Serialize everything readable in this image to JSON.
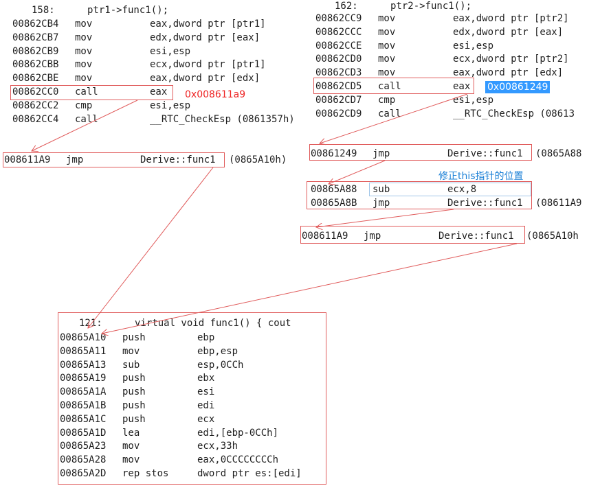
{
  "left_block": {
    "header_line": "158",
    "header_code": "ptr1->func1();",
    "rows": [
      {
        "addr": "00862CB4",
        "op": "mov",
        "args": "eax,dword ptr [ptr1]"
      },
      {
        "addr": "00862CB7",
        "op": "mov",
        "args": "edx,dword ptr [eax]"
      },
      {
        "addr": "00862CB9",
        "op": "mov",
        "args": "esi,esp"
      },
      {
        "addr": "00862CBB",
        "op": "mov",
        "args": "ecx,dword ptr [ptr1]"
      },
      {
        "addr": "00862CBE",
        "op": "mov",
        "args": "eax,dword ptr [edx]"
      },
      {
        "addr": "00862CC0",
        "op": "call",
        "args": "eax"
      },
      {
        "addr": "00862CC2",
        "op": "cmp",
        "args": "esi,esp"
      },
      {
        "addr": "00862CC4",
        "op": "call",
        "args": "__RTC_CheckEsp (0861357h)"
      }
    ],
    "annotation": "0x008611a9"
  },
  "left_jump": {
    "addr": "008611A9",
    "op": "jmp",
    "args": "Derive::func1",
    "suffix": "(0865A10h)"
  },
  "right_block": {
    "header_line": "162",
    "header_code": "ptr2->func1();",
    "rows": [
      {
        "addr": "00862CC9",
        "op": "mov",
        "args": "eax,dword ptr [ptr2]"
      },
      {
        "addr": "00862CCC",
        "op": "mov",
        "args": "edx,dword ptr [eax]"
      },
      {
        "addr": "00862CCE",
        "op": "mov",
        "args": "esi,esp"
      },
      {
        "addr": "00862CD0",
        "op": "mov",
        "args": "ecx,dword ptr [ptr2]"
      },
      {
        "addr": "00862CD3",
        "op": "mov",
        "args": "eax,dword ptr [edx]"
      },
      {
        "addr": "00862CD5",
        "op": "call",
        "args": "eax"
      },
      {
        "addr": "00862CD7",
        "op": "cmp",
        "args": "esi,esp"
      },
      {
        "addr": "00862CD9",
        "op": "call",
        "args": "__RTC_CheckEsp (08613"
      }
    ],
    "annotation": "0x00861249"
  },
  "right_jump1": {
    "addr": "00861249",
    "op": "jmp",
    "args": "Derive::func1",
    "suffix": "(0865A88"
  },
  "thunk_note": "修正this指针的位置",
  "thunk_rows": [
    {
      "addr": "00865A88",
      "op": "sub",
      "args": "ecx,8",
      "suffix": ""
    },
    {
      "addr": "00865A8B",
      "op": "jmp",
      "args": "Derive::func1",
      "suffix": "(08611A9"
    }
  ],
  "right_jump2": {
    "addr": "008611A9",
    "op": "jmp",
    "args": "Derive::func1",
    "suffix": "(0865A10h"
  },
  "func_block": {
    "header_line": "121",
    "header_code": "virtual void func1() { cout",
    "rows": [
      {
        "addr": "00865A10",
        "op": "push",
        "args": "ebp"
      },
      {
        "addr": "00865A11",
        "op": "mov",
        "args": "ebp,esp"
      },
      {
        "addr": "00865A13",
        "op": "sub",
        "args": "esp,0CCh"
      },
      {
        "addr": "00865A19",
        "op": "push",
        "args": "ebx"
      },
      {
        "addr": "00865A1A",
        "op": "push",
        "args": "esi"
      },
      {
        "addr": "00865A1B",
        "op": "push",
        "args": "edi"
      },
      {
        "addr": "00865A1C",
        "op": "push",
        "args": "ecx"
      },
      {
        "addr": "00865A1D",
        "op": "lea",
        "args": "edi,[ebp-0CCh]"
      },
      {
        "addr": "00865A23",
        "op": "mov",
        "args": "ecx,33h"
      },
      {
        "addr": "00865A28",
        "op": "mov",
        "args": "eax,0CCCCCCCCh"
      },
      {
        "addr": "00865A2D",
        "op": "rep stos",
        "args": "dword ptr es:[edi]"
      }
    ]
  },
  "colors": {
    "box": "#e05a5a",
    "arrow": "#e05a5a",
    "note_red": "#ee2222",
    "note_blue": "#1a7fd6",
    "highlight": "#3399ff"
  }
}
